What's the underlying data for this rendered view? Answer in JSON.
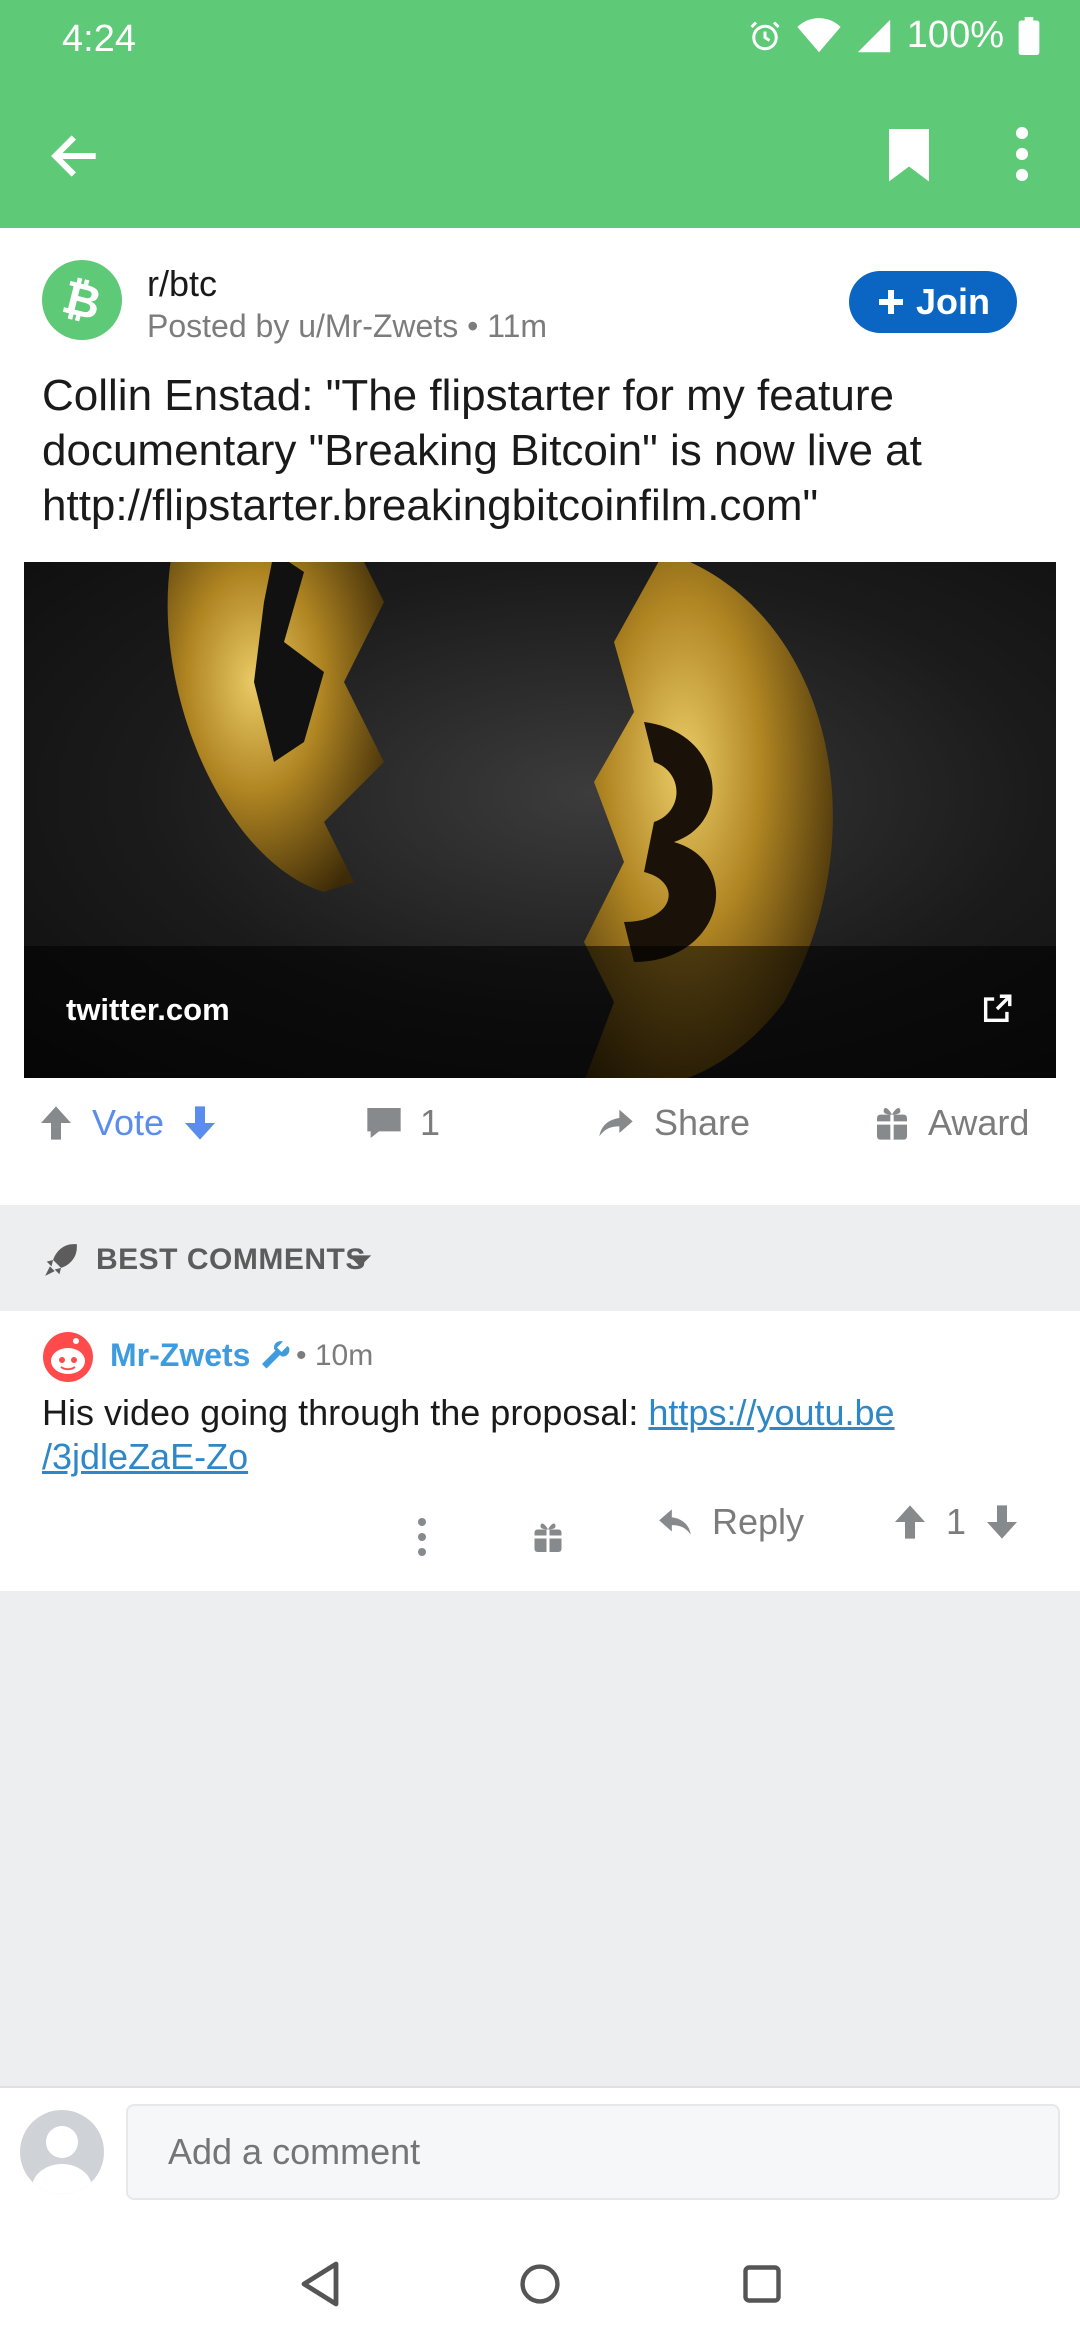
{
  "status_bar": {
    "time": "4:24",
    "battery": "100%"
  },
  "app_bar": {
    "back_icon": "arrow-left-icon",
    "save_icon": "bookmark-icon",
    "more_icon": "more-vertical-icon"
  },
  "post": {
    "subreddit": "r/btc",
    "posted_by": "Posted by u/Mr-Zwets • 11m",
    "join_label": "Join",
    "title": "Collin Enstad: \"The flipstarter for my feature documentary \"Breaking Bitcoin\" is now live at http://flipstarter.breakingbitcoinfilm.com\"",
    "link_domain": "twitter.com",
    "actions": {
      "vote_label": "Vote",
      "comment_count": "1",
      "share_label": "Share",
      "award_label": "Award"
    }
  },
  "sort": {
    "label": "BEST COMMENTS"
  },
  "comment": {
    "author": "Mr-Zwets",
    "age": "• 10m",
    "text": "His video going through the proposal: ",
    "link": "https://youtu.be/3jdleZaE-Zo",
    "link_line1": "https://youtu.be",
    "link_line2": "/3jdleZaE-Zo",
    "reply_label": "Reply",
    "score": "1"
  },
  "composer": {
    "placeholder": "Add a comment"
  },
  "colors": {
    "header_green": "#5ec977",
    "join_blue": "#0a66c2",
    "link_blue": "#2f87c7",
    "vote_blue": "#5b8def"
  }
}
